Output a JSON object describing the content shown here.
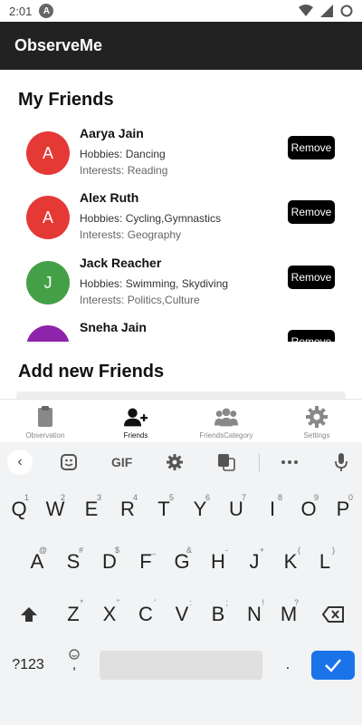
{
  "status_bar": {
    "time": "2:01",
    "notification_letter": "A"
  },
  "app_bar": {
    "title": "ObserveMe"
  },
  "my_friends": {
    "title": "My Friends",
    "remove_label": "Remove",
    "friends": [
      {
        "initial": "A",
        "name": "Aarya Jain",
        "hobbies": "Hobbies: Dancing",
        "interests": "Interests: Reading",
        "avatar_color": "#e53935"
      },
      {
        "initial": "A",
        "name": "Alex Ruth",
        "hobbies": "Hobbies: Cycling,Gymnastics",
        "interests": "Interests: Geography",
        "avatar_color": "#e53935"
      },
      {
        "initial": "J",
        "name": "Jack Reacher",
        "hobbies": "Hobbies: Swimming, Skydiving",
        "interests": "Interests: Politics,Culture",
        "avatar_color": "#43a047"
      },
      {
        "initial": "",
        "name": "Sneha Jain",
        "hobbies": "",
        "interests": "",
        "avatar_color": "#8e24aa"
      }
    ]
  },
  "add_new_friends": {
    "title": "Add new Friends"
  },
  "bottom_nav": {
    "items": [
      {
        "label": "Observation",
        "icon": "clipboard-icon"
      },
      {
        "label": "Friends",
        "icon": "add-person-icon"
      },
      {
        "label": "FriendsCategory",
        "icon": "group-icon"
      },
      {
        "label": "Settings",
        "icon": "gear-icon"
      }
    ]
  },
  "keyboard": {
    "toolbar": {
      "gif": "GIF"
    },
    "row1": {
      "keys": [
        "Q",
        "W",
        "E",
        "R",
        "T",
        "Y",
        "U",
        "I",
        "O",
        "P"
      ],
      "hints": [
        "1",
        "2",
        "3",
        "4",
        "5",
        "6",
        "7",
        "8",
        "9",
        "0"
      ]
    },
    "row2": {
      "keys": [
        "A",
        "S",
        "D",
        "F",
        "G",
        "H",
        "J",
        "K",
        "L"
      ],
      "hints": [
        "@",
        "#",
        "$",
        "_",
        "&",
        "-",
        "+",
        "(",
        ")"
      ]
    },
    "row3": {
      "keys": [
        "Z",
        "X",
        "C",
        "V",
        "B",
        "N",
        "M"
      ],
      "hints": [
        "*",
        "\"",
        "'",
        ":",
        ";",
        "!",
        "?"
      ]
    },
    "bottom": {
      "symbols": "?123",
      "comma": ",",
      "period": "."
    }
  }
}
